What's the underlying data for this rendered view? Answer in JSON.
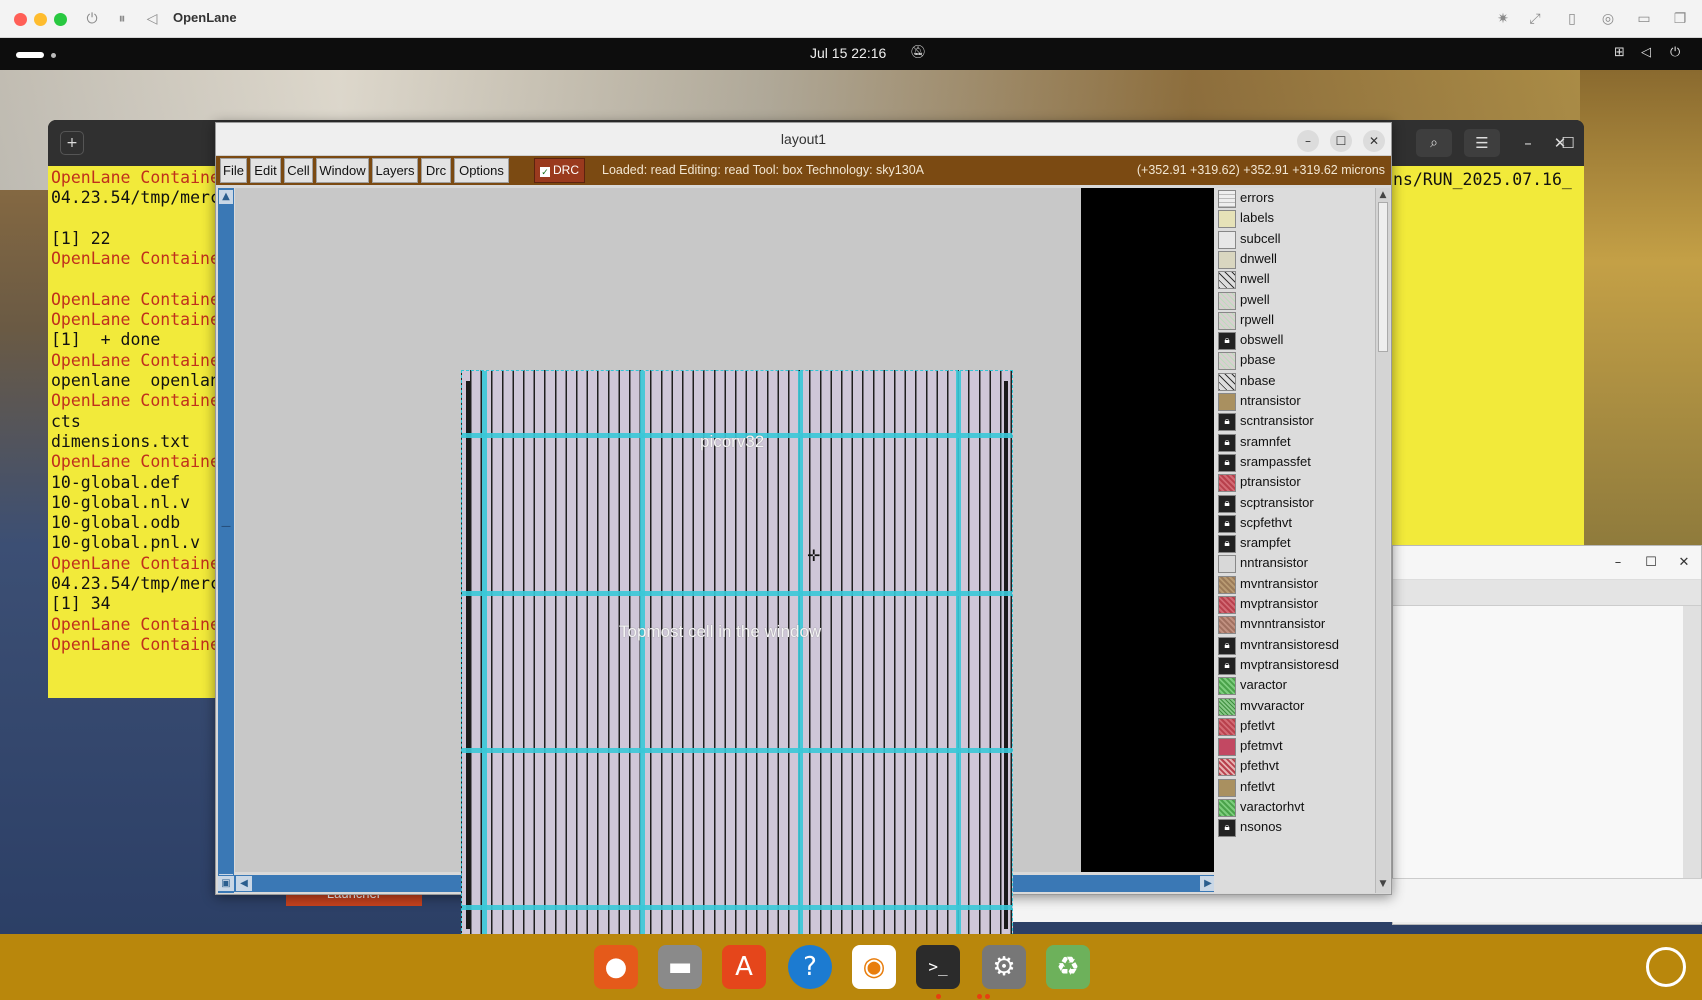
{
  "host": {
    "title": "OpenLane"
  },
  "topbar": {
    "clock": "Jul 15  22:16"
  },
  "terminal": {
    "lines": [
      {
        "text": "OpenLane Containe",
        "color": "red"
      },
      {
        "text": "04.23.54/tmp/merc",
        "color": "blk"
      },
      {
        "text": "",
        "color": "blk"
      },
      {
        "text": "[1] 22",
        "color": "blk"
      },
      {
        "text": "OpenLane Containe",
        "color": "red"
      },
      {
        "text": "",
        "color": "blk"
      },
      {
        "text": "OpenLane Containe",
        "color": "red"
      },
      {
        "text": "OpenLane Containe",
        "color": "red"
      },
      {
        "text": "[1]  + done",
        "color": "blk"
      },
      {
        "text": "OpenLane Containe",
        "color": "red"
      },
      {
        "text": "openlane  openlan",
        "color": "blk"
      },
      {
        "text": "OpenLane Containe",
        "color": "red"
      },
      {
        "text": "cts",
        "color": "blk"
      },
      {
        "text": "dimensions.txt",
        "color": "blk"
      },
      {
        "text": "OpenLane Containe",
        "color": "red"
      },
      {
        "text": "10-global.def",
        "color": "blk"
      },
      {
        "text": "10-global.nl.v",
        "color": "blk"
      },
      {
        "text": "10-global.odb",
        "color": "blk"
      },
      {
        "text": "10-global.pnl.v",
        "color": "blk"
      },
      {
        "text": "OpenLane Containe",
        "color": "red"
      },
      {
        "text": "04.23.54/tmp/merc",
        "color": "blk"
      },
      {
        "text": "[1] 34",
        "color": "blk"
      },
      {
        "text": "OpenLane Containe",
        "color": "red"
      },
      {
        "text": "OpenLane Containe",
        "color": "red"
      }
    ],
    "right_path": "ns/RUN_2025.07.16_"
  },
  "tkcon": {
    "launcher": "Launcher",
    "message": "La",
    "prompt": "%"
  },
  "magic": {
    "title": "layout1",
    "menus": [
      "File",
      "Edit",
      "Cell",
      "Window",
      "Layers",
      "Drc",
      "Options"
    ],
    "drc_label": "DRC",
    "status": "Loaded: read Editing: read Tool: box  Technology: sky130A",
    "coords": "(+352.91 +319.62) +352.91 +319.62 microns",
    "cell_name": "picorv32",
    "cell_caption": "Topmost cell in the window",
    "layers": [
      {
        "name": "errors",
        "style": "grid"
      },
      {
        "name": "labels",
        "style": "labels"
      },
      {
        "name": "subcell",
        "style": "subcell"
      },
      {
        "name": "dnwell",
        "style": "dnwell"
      },
      {
        "name": "nwell",
        "style": "hatch"
      },
      {
        "name": "pwell",
        "style": "pwell"
      },
      {
        "name": "rpwell",
        "style": "pwell"
      },
      {
        "name": "obswell",
        "style": "lock"
      },
      {
        "name": "pbase",
        "style": "pwell"
      },
      {
        "name": "nbase",
        "style": "hatch"
      },
      {
        "name": "ntransistor",
        "style": "ntr"
      },
      {
        "name": "scntransistor",
        "style": "lock"
      },
      {
        "name": "sramnfet",
        "style": "lock"
      },
      {
        "name": "srampassfet",
        "style": "lock"
      },
      {
        "name": "ptransistor",
        "style": "ptr"
      },
      {
        "name": "scptransistor",
        "style": "lock"
      },
      {
        "name": "scpfethvt",
        "style": "lock"
      },
      {
        "name": "srampfet",
        "style": "lock"
      },
      {
        "name": "nntransistor",
        "style": "plain"
      },
      {
        "name": "mvntransistor",
        "style": "mvn"
      },
      {
        "name": "mvptransistor",
        "style": "ptr"
      },
      {
        "name": "mvnntransistor",
        "style": "mvnn"
      },
      {
        "name": "mvntransistoresd",
        "style": "lock"
      },
      {
        "name": "mvptransistoresd",
        "style": "lock"
      },
      {
        "name": "varactor",
        "style": "green"
      },
      {
        "name": "mvvaractor",
        "style": "green2"
      },
      {
        "name": "pfetlvt",
        "style": "ptr"
      },
      {
        "name": "pfetmvt",
        "style": "pink"
      },
      {
        "name": "pfethvt",
        "style": "ptrh"
      },
      {
        "name": "nfetlvt",
        "style": "ntr"
      },
      {
        "name": "varactorhvt",
        "style": "green"
      },
      {
        "name": "nsonos",
        "style": "lock"
      }
    ],
    "colors": {
      "menubar": "#7b4a12",
      "drc": "#9a3a1e",
      "chip_fill": "#cfc7d8",
      "power_grid": "#38c8d8",
      "scrollbar": "#3a78b5"
    }
  },
  "dock": {
    "apps": [
      {
        "name": "firefox-icon",
        "glyph": "●"
      },
      {
        "name": "files-icon",
        "glyph": "▬"
      },
      {
        "name": "app-center-icon",
        "glyph": "A"
      },
      {
        "name": "help-icon",
        "glyph": "?"
      },
      {
        "name": "blender-icon",
        "glyph": "◉"
      },
      {
        "name": "terminal-icon",
        "glyph": ">_"
      },
      {
        "name": "settings-icon",
        "glyph": "⚙"
      },
      {
        "name": "trash-icon",
        "glyph": "♻"
      }
    ]
  }
}
